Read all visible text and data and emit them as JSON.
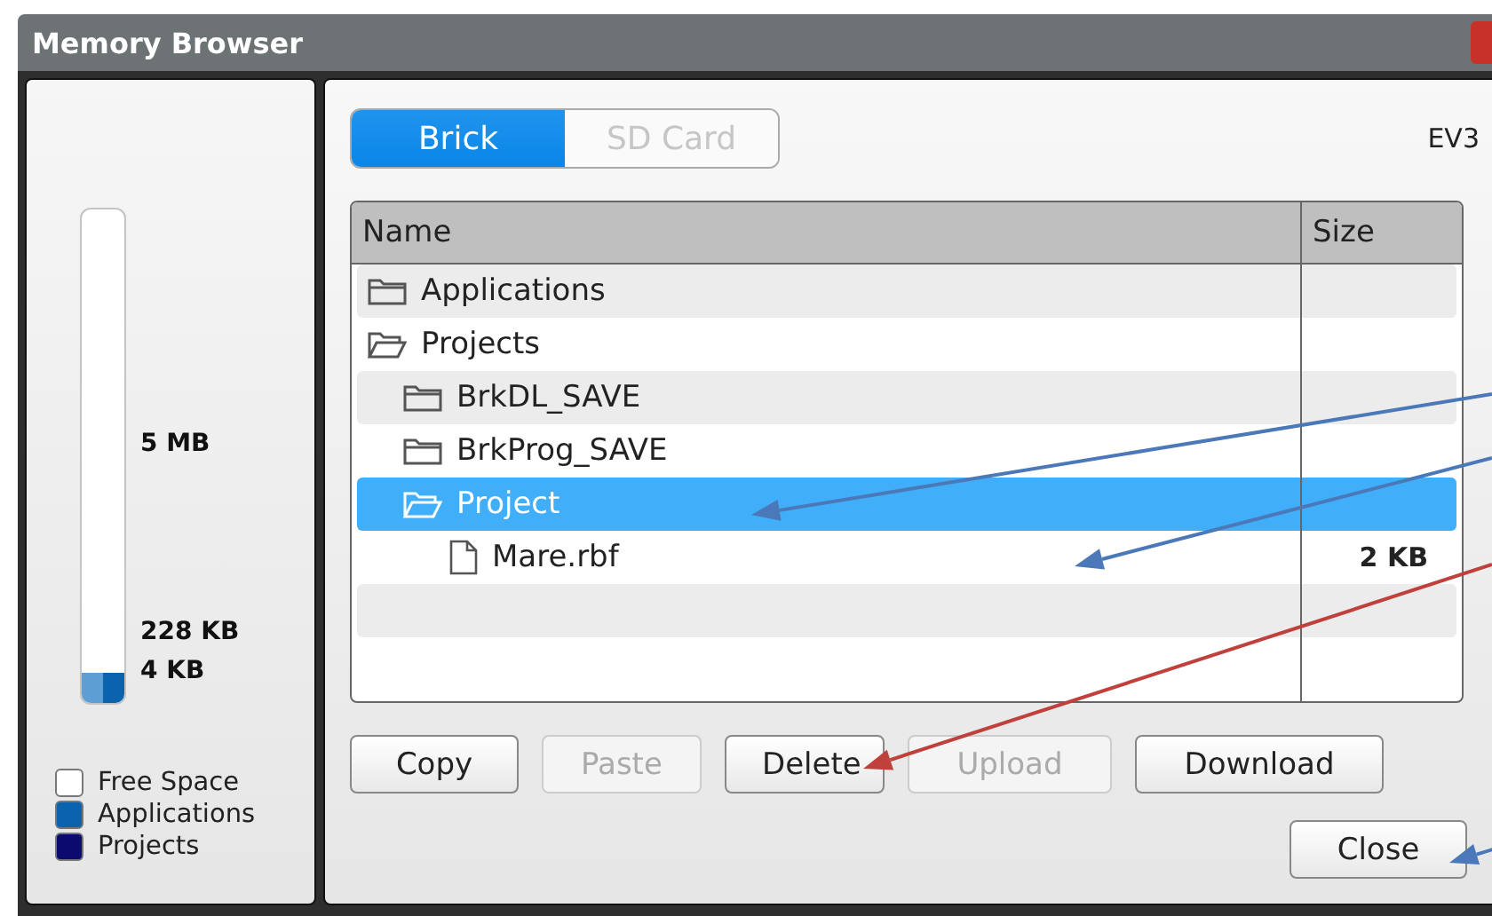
{
  "window": {
    "title": "Memory Browser"
  },
  "memory": {
    "bar": {
      "level": 0.06
    },
    "labels": [
      "5 MB",
      "228 KB",
      "4 KB"
    ],
    "legend": [
      {
        "label": "Free Space",
        "color": "#ffffff"
      },
      {
        "label": "Applications",
        "color": "#0b63ad"
      },
      {
        "label": "Projects",
        "color": "#0b0a6e"
      }
    ]
  },
  "tabs": [
    {
      "label": "Brick",
      "selected": true
    },
    {
      "label": "SD Card",
      "selected": false
    }
  ],
  "device": "EV3",
  "table": {
    "columns": [
      "Name",
      "Size"
    ],
    "rows": [
      {
        "name": "Applications",
        "kind": "folder",
        "expanded": false,
        "selected": false
      },
      {
        "name": "Projects",
        "kind": "folder",
        "expanded": true,
        "selected": false,
        "children": [
          {
            "name": "BrkDL_SAVE",
            "kind": "folder",
            "expanded": false,
            "selected": false
          },
          {
            "name": "BrkProg_SAVE",
            "kind": "folder",
            "expanded": false,
            "selected": false
          },
          {
            "name": "Project",
            "kind": "folder",
            "expanded": true,
            "selected": true,
            "children": [
              {
                "name": "Mare.rbf",
                "kind": "file",
                "size": "2 KB",
                "selected": false
              }
            ]
          }
        ]
      }
    ]
  },
  "buttons": [
    {
      "label": "Copy",
      "disabled": false
    },
    {
      "label": "Paste",
      "disabled": true
    },
    {
      "label": "Delete",
      "disabled": false
    },
    {
      "label": "Upload",
      "disabled": true
    },
    {
      "label": "Download",
      "disabled": false
    }
  ],
  "close_button": {
    "label": "Close"
  }
}
